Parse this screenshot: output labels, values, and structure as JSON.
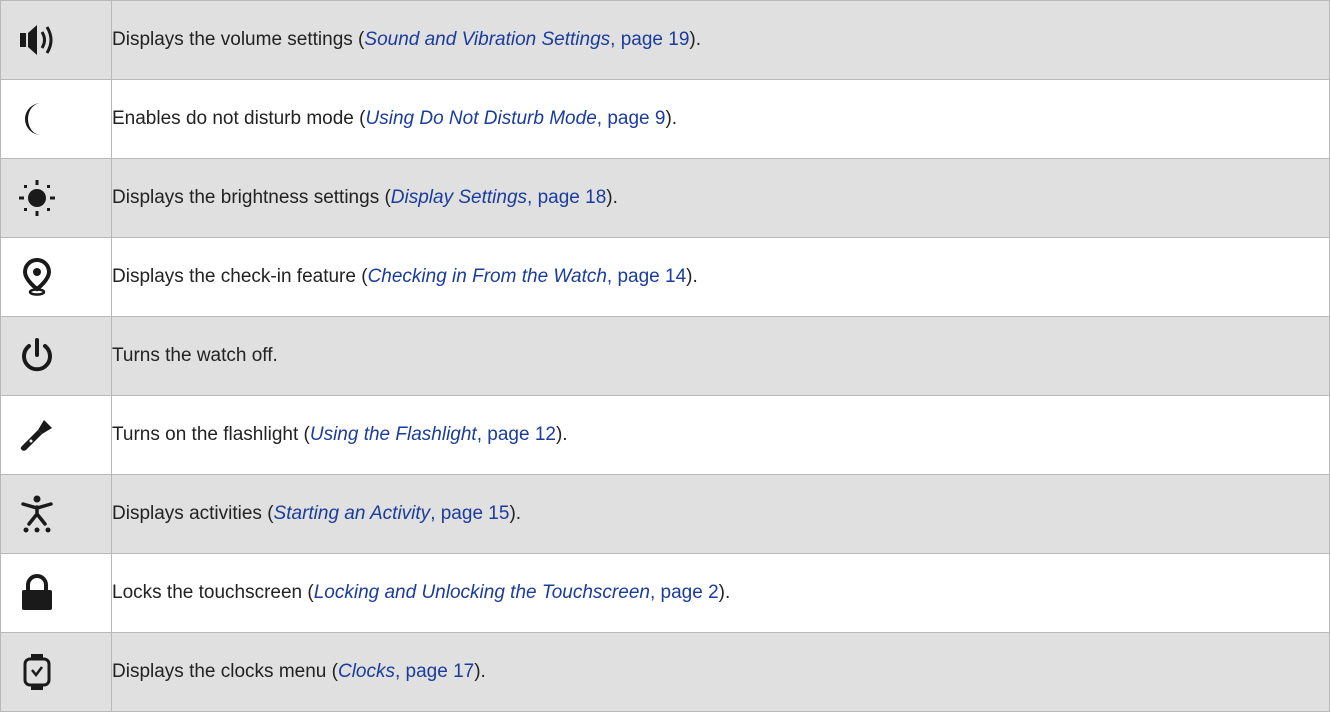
{
  "rows": [
    {
      "icon": "volume-icon",
      "text": "Displays the volume settings (",
      "link_title": "Sound and Vibration Settings",
      "link_page": ", page 19",
      "tail": ")."
    },
    {
      "icon": "moon-icon",
      "text": "Enables do not disturb mode (",
      "link_title": "Using Do Not Disturb Mode",
      "link_page": ", page 9",
      "tail": ")."
    },
    {
      "icon": "brightness-icon",
      "text": "Displays the brightness settings (",
      "link_title": "Display Settings",
      "link_page": ", page 18",
      "tail": ")."
    },
    {
      "icon": "location-pin-icon",
      "text": "Displays the check-in feature (",
      "link_title": "Checking in From the Watch",
      "link_page": ", page 14",
      "tail": ")."
    },
    {
      "icon": "power-icon",
      "text": "Turns the watch off.",
      "link_title": "",
      "link_page": "",
      "tail": ""
    },
    {
      "icon": "flashlight-icon",
      "text": "Turns on the flashlight (",
      "link_title": "Using the Flashlight",
      "link_page": ", page 12",
      "tail": ")."
    },
    {
      "icon": "activity-icon",
      "text": "Displays activities (",
      "link_title": "Starting an Activity",
      "link_page": ", page 15",
      "tail": ")."
    },
    {
      "icon": "lock-icon",
      "text": "Locks the touchscreen (",
      "link_title": "Locking and Unlocking the Touchscreen",
      "link_page": ", page 2",
      "tail": ")."
    },
    {
      "icon": "watch-clock-icon",
      "text": "Displays the clocks menu (",
      "link_title": "Clocks",
      "link_page": ", page 17",
      "tail": ")."
    }
  ],
  "colors": {
    "link": "#1a3c9c",
    "row_shaded": "#e0e0e0",
    "row_plain": "#ffffff",
    "icon": "#1a1a1a"
  }
}
